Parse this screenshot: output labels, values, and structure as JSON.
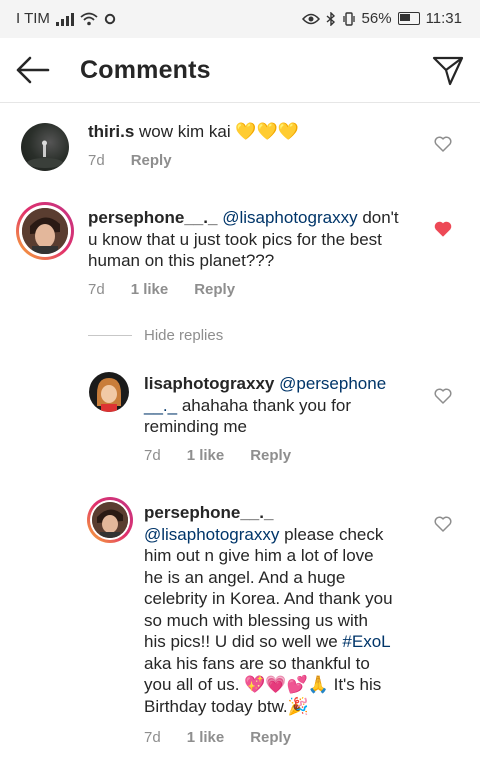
{
  "status": {
    "carrier": "I TIM",
    "battery": "56%",
    "time": "11:31"
  },
  "header": {
    "title": "Comments"
  },
  "comments": [
    {
      "username": "thiri.s",
      "text": "wow kim kai",
      "emoji": "💛💛💛",
      "age": "7d",
      "reply": "Reply"
    },
    {
      "username": "persephone__._",
      "mention": "@lisaphotograxxy",
      "text_l1": "don't",
      "text_l2": "u know that u just took pics for the best",
      "text_l3": "human on this planet???",
      "age": "7d",
      "likes": "1 like",
      "reply": "Reply",
      "liked": true
    }
  ],
  "hide_replies": "Hide replies",
  "replies": [
    {
      "username": "lisaphotograxxy",
      "mention_l1": "@persephone",
      "mention_l2": "__._",
      "text_l2": "ahahaha thank you for",
      "text_l3": "reminding me",
      "age": "7d",
      "likes": "1 like",
      "reply": "Reply"
    },
    {
      "username": "persephone__._",
      "mention": "@lisaphotograxxy",
      "text_l2": "please check",
      "text_l3": "him out n give him a lot of love",
      "text_l4": "he is an angel. And a huge",
      "text_l5": "celebrity in Korea. And thank you",
      "text_l6": "so much with blessing us with",
      "text_l7": "his pics!! U did so well we",
      "hashtag": "#ExoL",
      "text_l8": "aka his fans are so thankful to",
      "text_l9": "you all of us.",
      "emoji_l9": "💖💗💕🙏",
      "text_l9b": "It's his",
      "text_l10": "Birthday today btw.",
      "emoji_l10": "🎉",
      "age": "7d",
      "likes": "1 like",
      "reply": "Reply"
    }
  ],
  "colors": {
    "like_red": "#ed4956",
    "mention_blue": "#003569",
    "meta_gray": "#8e8e8e"
  }
}
